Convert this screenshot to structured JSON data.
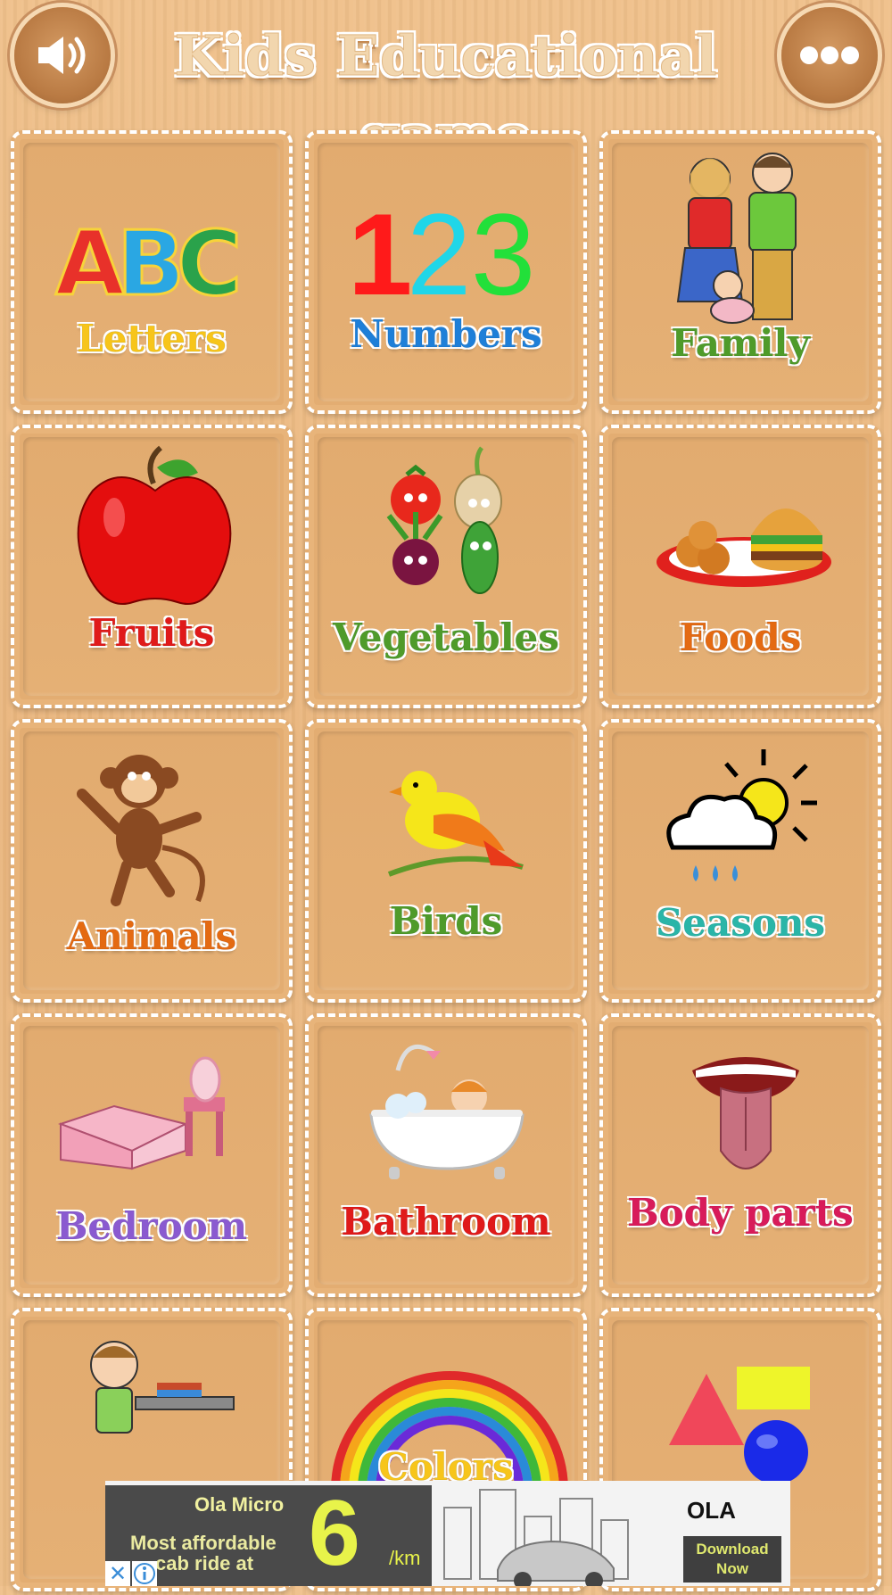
{
  "header": {
    "title": "Kids Educational game",
    "sound_icon": "speaker-icon",
    "menu_icon": "more-dots-icon"
  },
  "categories": [
    {
      "label": "Letters",
      "color": "#f7c51b",
      "icon": "abc-letters-icon"
    },
    {
      "label": "Numbers",
      "color": "#1e7fd8",
      "icon": "numbers-123-icon"
    },
    {
      "label": "Family",
      "color": "#4f9b2a",
      "icon": "family-icon"
    },
    {
      "label": "Fruits",
      "color": "#e01a1a",
      "icon": "apple-icon"
    },
    {
      "label": "Vegetables",
      "color": "#4f9b2a",
      "icon": "vegetables-icon"
    },
    {
      "label": "Foods",
      "color": "#e46a12",
      "icon": "food-plate-icon"
    },
    {
      "label": "Animals",
      "color": "#e46a12",
      "icon": "monkey-icon"
    },
    {
      "label": "Birds",
      "color": "#4f9b2a",
      "icon": "bird-icon"
    },
    {
      "label": "Seasons",
      "color": "#2ab5a8",
      "icon": "weather-icon"
    },
    {
      "label": "Bedroom",
      "color": "#8a5ad0",
      "icon": "bed-icon"
    },
    {
      "label": "Bathroom",
      "color": "#e01a1a",
      "icon": "bathtub-icon"
    },
    {
      "label": "Body   parts",
      "color": "#d81b5a",
      "icon": "tongue-icon"
    },
    {
      "label": "",
      "color": "#333333",
      "icon": "student-desk-icon"
    },
    {
      "label": "Colors",
      "color": "#f7c51b",
      "icon": "rainbow-icon"
    },
    {
      "label": "",
      "color": "#333333",
      "icon": "shapes-icon"
    }
  ],
  "ad": {
    "brand_title": "Ola Micro",
    "price": "6",
    "unit": "/km",
    "line1": "Most affordable",
    "line2": "cab ride at",
    "logo": "OLA",
    "cta": "Download Now"
  }
}
